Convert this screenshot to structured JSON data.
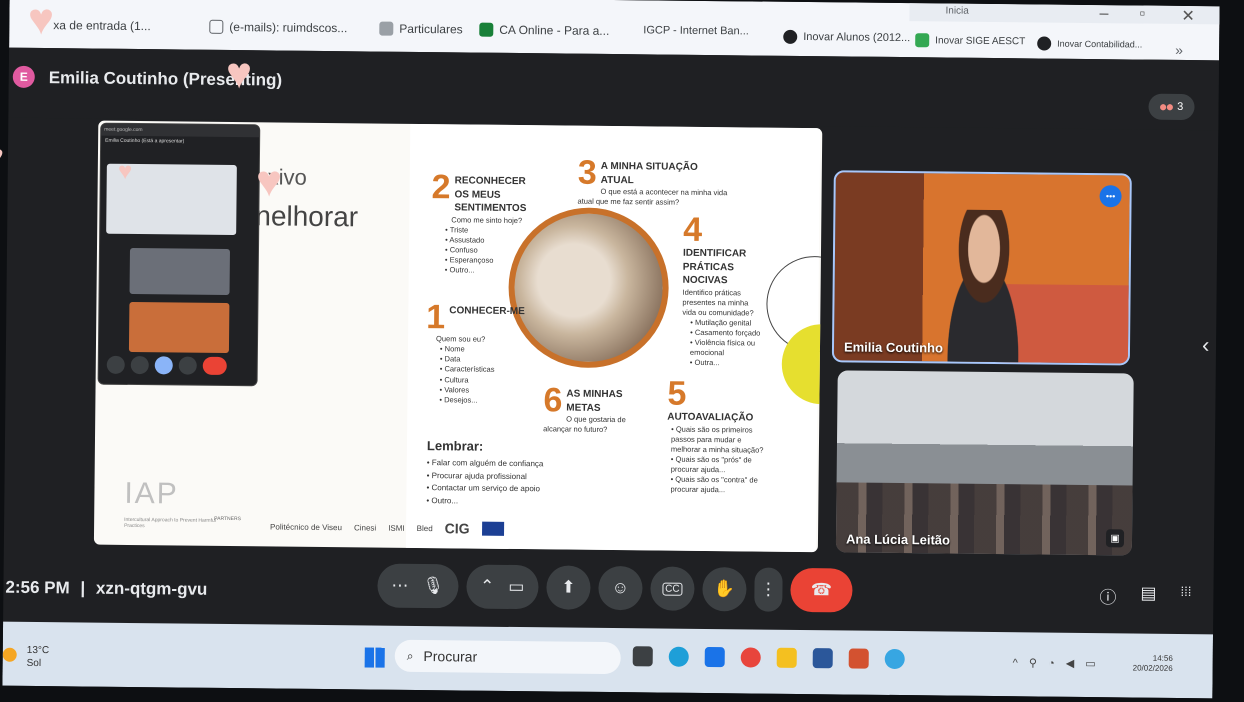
{
  "browser": {
    "bookmarks": [
      {
        "label": "xa de entrada (1...",
        "color": "#d93025"
      },
      {
        "label": "(e-mails): ruimdscos...",
        "color": "#1a73e8"
      },
      {
        "label": "Particulares",
        "color": "#5f6368"
      },
      {
        "label": "CA Online - Para a...",
        "color": "#188038"
      },
      {
        "label": "IGCP - Internet Ban...",
        "color": "#ffffff"
      },
      {
        "label": "Inovar Alunos (2012...",
        "color": "#202124"
      },
      {
        "label": "Inovar SIGE AESCT",
        "color": "#34a853"
      },
      {
        "label": "Inovar Contabilidad...",
        "color": "#202124"
      }
    ],
    "tab_text": "Inicia",
    "more": "»"
  },
  "meet": {
    "presenter_initial": "E",
    "presenter_title": "Emilia Coutinho (Presenting)",
    "participant_count": "3",
    "meeting_time": "2:56 PM",
    "separator": "|",
    "meeting_code": "xzn-qtgm-gvu"
  },
  "slide": {
    "title_line1": "xivo",
    "title_line2": "nelhorar",
    "steps": [
      {
        "num": "2",
        "head": "Reconhecer os meus sentimentos",
        "question": "Como me sinto hoje?",
        "items": [
          "Triste",
          "Assustado",
          "Confuso",
          "Esperançoso",
          "Outro..."
        ]
      },
      {
        "num": "3",
        "head": "A minha situação atual",
        "question": "O que está a acontecer na minha vida atual que me faz sentir assim?",
        "items": []
      },
      {
        "num": "4",
        "head": "Identificar práticas nocivas",
        "question": "Identifico práticas presentes na minha vida ou comunidade?",
        "items": [
          "Mutilação genital",
          "Casamento forçado",
          "Violência física ou emocional",
          "Outra..."
        ]
      },
      {
        "num": "1",
        "head": "Conhecer-me",
        "question": "Quem sou eu?",
        "items": [
          "Nome",
          "Data",
          "Características",
          "Cultura",
          "Valores",
          "Desejos..."
        ]
      },
      {
        "num": "6",
        "head": "As minhas metas",
        "question": "O que gostaria de alcançar no futuro?",
        "items": []
      },
      {
        "num": "5",
        "head": "Autoavaliação",
        "question": "",
        "items": [
          "Quais são os primeiros passos para mudar e melhorar a minha situação?",
          "Quais são os \"prós\" de procurar ajuda...",
          "Quais são os \"contra\" de procurar ajuda..."
        ]
      }
    ],
    "lembrar_title": "Lembrar:",
    "lembrar_items": [
      "Falar com alguém de confiança",
      "Procurar ajuda profissional",
      "Contactar um serviço de apoio",
      "Outro..."
    ],
    "logo": "IAP",
    "logo_sub": "Intercultural Approach to Prevent Harmful Practices",
    "partners_label": "PARTNERS",
    "partner_names": [
      "Politécnico de Viseu",
      "Cinesi",
      "ISMI",
      "Bled",
      "CIG"
    ]
  },
  "selfview": {
    "head": "meet.google.com",
    "name": "Emilia Coutinho (Está a apresentar)"
  },
  "participants": [
    {
      "name": "Emilia Coutinho"
    },
    {
      "name": "Ana Lúcia Leitão"
    }
  ],
  "icons": {
    "more": "⋯",
    "mic": "🎙",
    "chevron_up": "⌃",
    "camera": "▭",
    "present": "⬆",
    "emoji": "☺",
    "captions": "CC",
    "hand": "✋",
    "options": "⋮",
    "end_call": "☎",
    "info": "ⓘ",
    "chat": "▤",
    "activities": "⁞⁞⁞",
    "pin": "⬤⬤",
    "side_chevron": "‹",
    "search": "🔍"
  },
  "taskbar": {
    "temperature": "13°C",
    "weather": "Sol",
    "search_placeholder": "Procurar",
    "time": "14:56",
    "date": "20/02/2026"
  }
}
